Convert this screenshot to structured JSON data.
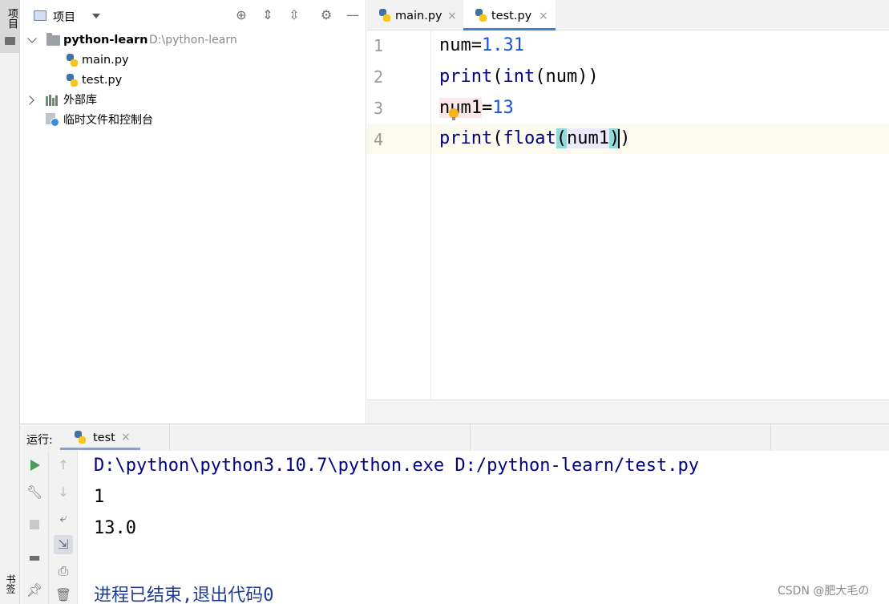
{
  "left_strip": {
    "project_tab_label": "项目",
    "bookmarks_label": "书签"
  },
  "project_panel": {
    "title": "项目",
    "tree": {
      "root_name": "python-learn",
      "root_path": "D:\\python-learn",
      "files": [
        "main.py",
        "test.py"
      ],
      "external_libraries": "外部库",
      "scratches": "临时文件和控制台"
    }
  },
  "editor": {
    "tabs": [
      {
        "label": "main.py",
        "active": false
      },
      {
        "label": "test.py",
        "active": true
      }
    ],
    "line_numbers": [
      "1",
      "2",
      "3",
      "4"
    ],
    "code": {
      "l1": {
        "name": "num",
        "eq": "=",
        "value": "1.31"
      },
      "l2": {
        "fn": "print",
        "open": "(",
        "inner_fn": "int",
        "inner_open": "(",
        "arg": "num",
        "close": "))"
      },
      "l3": {
        "name": "num1",
        "eq": "=",
        "value": "13"
      },
      "l4": {
        "fn": "print",
        "open": "(",
        "inner_fn": "float",
        "inner_open": "(",
        "arg": "num1",
        "inner_close": ")",
        "close": ")"
      }
    }
  },
  "run_panel": {
    "label": "运行:",
    "tab_label": "test",
    "console": {
      "command": "D:\\python\\python3.10.7\\python.exe D:/python-learn/test.py",
      "output": [
        "1",
        "13.0"
      ],
      "exit_message": "进程已结束,退出代码0"
    }
  },
  "watermark": "CSDN @肥大毛の",
  "colors": {
    "accent": "#4083c9",
    "number": "#1750eb",
    "builtin": "#000080",
    "run_green": "#4c9a5b"
  }
}
